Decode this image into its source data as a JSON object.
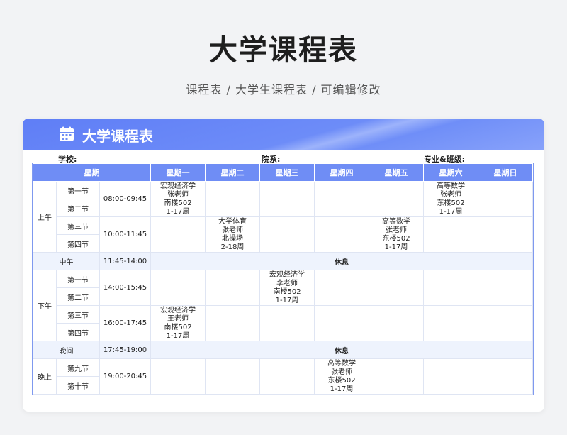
{
  "header": {
    "title": "大学课程表",
    "subtitle": "课程表 / 大学生课程表 / 可编辑修改"
  },
  "card": {
    "title": "大学课程表",
    "icon": "calendar-icon",
    "school_label": "学校:",
    "department_label": "院系:",
    "major_label": "专业&班级:"
  },
  "table": {
    "header_weekday": "星期",
    "days": [
      "星期一",
      "星期二",
      "星期三",
      "星期四",
      "星期五",
      "星期六",
      "星期日"
    ],
    "periods": {
      "morning": "上午",
      "noon": "中午",
      "afternoon": "下午",
      "dusk": "晚间",
      "evening": "晚上"
    },
    "sessions": {
      "s1": "第一节",
      "s2": "第二节",
      "s3": "第三节",
      "s4": "第四节",
      "s5": "第一节",
      "s6": "第二节",
      "s7": "第三节",
      "s8": "第四节",
      "s9": "第九节",
      "s10": "第十节"
    },
    "times": {
      "t1": "08:00-09:45",
      "t2": "10:00-11:45",
      "noon": "11:45-14:00",
      "t3": "14:00-15:45",
      "t4": "16:00-17:45",
      "dusk": "17:45-19:00",
      "t5": "19:00-20:45"
    },
    "rest_label": "休息",
    "courses": {
      "mon_1": [
        "宏观经济学",
        "张老师",
        "南楼502",
        "1-17周"
      ],
      "sat_1": [
        "高等数学",
        "张老师",
        "东楼502",
        "1-17周"
      ],
      "tue_2": [
        "大学体育",
        "张老师",
        "北操场",
        "2-18周"
      ],
      "fri_2": [
        "高等数学",
        "张老师",
        "东楼502",
        "1-17周"
      ],
      "wed_3": [
        "宏观经济学",
        "李老师",
        "南楼502",
        "1-17周"
      ],
      "mon_4": [
        "宏观经济学",
        "王老师",
        "南楼502",
        "1-17周"
      ],
      "thu_5": [
        "高等数学",
        "张老师",
        "东楼502",
        "1-17周"
      ]
    }
  },
  "colors": {
    "accent": "#6f8df5",
    "rest_bg": "#eef3fd",
    "rest_text": "#4a6bdc"
  }
}
